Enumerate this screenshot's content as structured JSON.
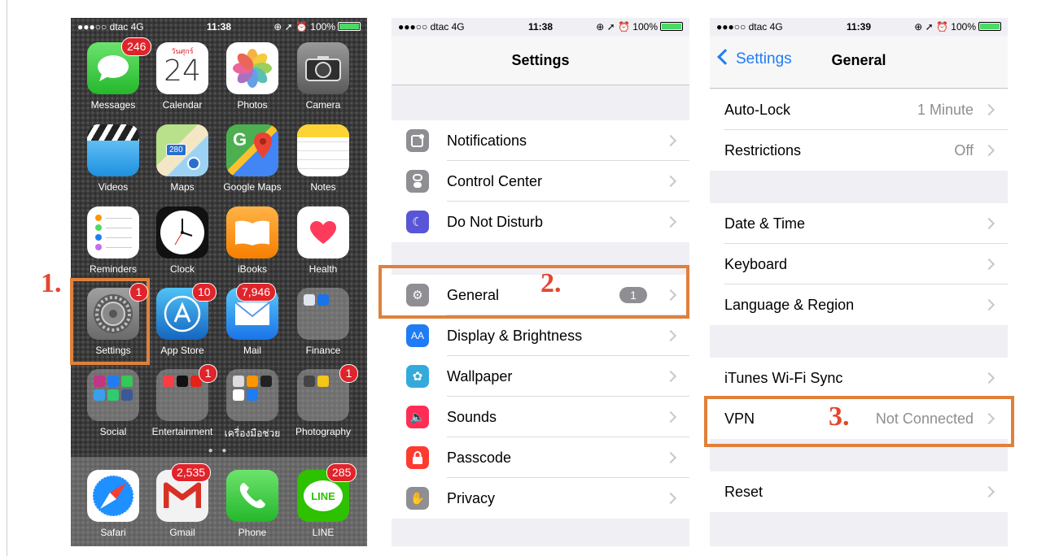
{
  "home": {
    "status": {
      "carrier": "●●●○○ dtac 4G",
      "time": "11:38",
      "right": "⊕ ➚ ⏰ 100%"
    },
    "apps": {
      "messages": {
        "label": "Messages",
        "badge": "246"
      },
      "calendar": {
        "label": "Calendar",
        "day_name": "วันศุกร์",
        "date": "24"
      },
      "photos": {
        "label": "Photos"
      },
      "camera": {
        "label": "Camera"
      },
      "videos": {
        "label": "Videos"
      },
      "maps": {
        "label": "Maps",
        "shield": "280"
      },
      "google_maps": {
        "label": "Google Maps"
      },
      "notes": {
        "label": "Notes"
      },
      "reminders": {
        "label": "Reminders"
      },
      "clock": {
        "label": "Clock"
      },
      "ibooks": {
        "label": "iBooks"
      },
      "health": {
        "label": "Health"
      },
      "settings": {
        "label": "Settings",
        "badge": "1"
      },
      "app_store": {
        "label": "App Store",
        "badge": "10"
      },
      "mail": {
        "label": "Mail",
        "badge": "7,946"
      },
      "finance": {
        "label": "Finance"
      },
      "social": {
        "label": "Social"
      },
      "entertainment": {
        "label": "Entertainment",
        "badge": "1"
      },
      "tools": {
        "label": "เครื่องมือช่วย",
        "badge": "1"
      },
      "photography": {
        "label": "Photography",
        "badge": "1"
      },
      "safari": {
        "label": "Safari"
      },
      "gmail": {
        "label": "Gmail",
        "badge": "2,535"
      },
      "phone": {
        "label": "Phone"
      },
      "line": {
        "label": "LINE",
        "badge": "285",
        "logo": "LINE"
      }
    },
    "page_dots": "● ●"
  },
  "steps": {
    "one": "1.",
    "two": "2.",
    "three": "3."
  },
  "settings": {
    "status": {
      "carrier": "●●●○○ dtac 4G",
      "time": "11:38",
      "right": "⊕ ➚ ⏰ 100%"
    },
    "title": "Settings",
    "items": [
      {
        "label": "Notifications",
        "icon": "notifications-icon"
      },
      {
        "label": "Control Center",
        "icon": "control-center-icon"
      },
      {
        "label": "Do Not Disturb",
        "icon": "moon-icon"
      },
      {
        "label": "General",
        "icon": "gear-icon",
        "badge": "1"
      },
      {
        "label": "Display & Brightness",
        "icon": "display-icon",
        "glyph": "AA"
      },
      {
        "label": "Wallpaper",
        "icon": "wallpaper-icon"
      },
      {
        "label": "Sounds",
        "icon": "speaker-icon"
      },
      {
        "label": "Passcode",
        "icon": "lock-icon"
      },
      {
        "label": "Privacy",
        "icon": "hand-icon"
      }
    ]
  },
  "general": {
    "status": {
      "carrier": "●●●○○ dtac 4G",
      "time": "11:39",
      "right": "⊕ ➚ ⏰ 100%"
    },
    "back": "Settings",
    "title": "General",
    "items": [
      {
        "label": "Auto-Lock",
        "value": "1 Minute"
      },
      {
        "label": "Restrictions",
        "value": "Off"
      },
      {
        "label": "Date & Time"
      },
      {
        "label": "Keyboard"
      },
      {
        "label": "Language & Region"
      },
      {
        "label": "iTunes Wi-Fi Sync"
      },
      {
        "label": "VPN",
        "value": "Not Connected"
      },
      {
        "label": "Reset"
      }
    ]
  },
  "colors": {
    "highlight": "#e0803b",
    "step": "#e2472f",
    "ios_blue": "#1f7cf4",
    "badge_red": "#e0242b"
  }
}
